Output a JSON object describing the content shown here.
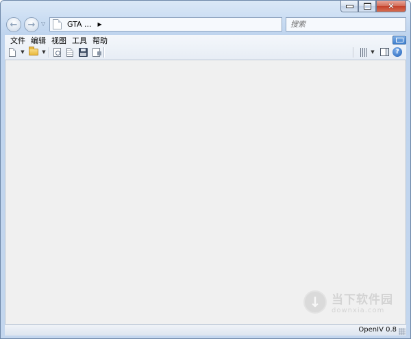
{
  "titlebar": {
    "minimize_icon": "minimize-icon",
    "maximize_icon": "maximize-icon",
    "close_icon": "close-icon",
    "close_color": "#c4412b"
  },
  "nav": {
    "back_icon": "arrow-left-icon",
    "forward_icon": "arrow-right-icon",
    "address_text": "GTA ...",
    "search_placeholder": "搜索"
  },
  "menu": {
    "items": [
      "文件",
      "编辑",
      "视图",
      "工具",
      "帮助"
    ]
  },
  "toolbar": {
    "icons": [
      "new-document-icon",
      "open-folder-icon",
      "find-icon",
      "document-icon",
      "save-icon",
      "export-icon",
      "columns-icon",
      "preview-pane-icon",
      "help-icon"
    ],
    "help_glyph": "?"
  },
  "status": {
    "version": "OpenIV 0.8"
  },
  "watermark": {
    "site_cn": "当下软件园",
    "site_en": "downxia.com"
  }
}
